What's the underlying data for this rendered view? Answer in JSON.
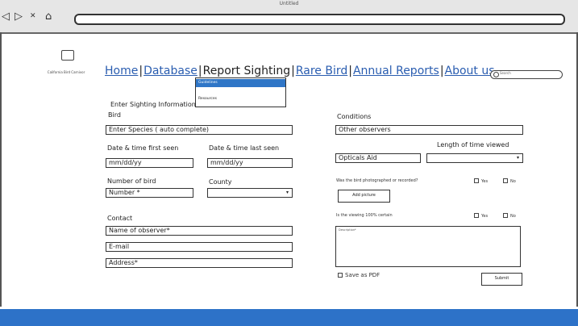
{
  "browser": {
    "title": "Untitled",
    "back_glyph": "◁",
    "forward_glyph": "▷",
    "close_glyph": "✕",
    "home_glyph": "⌂"
  },
  "logo": {
    "text": "California Bird Carnivor"
  },
  "nav": {
    "home": "Home",
    "database": "Database",
    "report": "Report Sighting",
    "rare": "Rare Bird",
    "annual": "Annual Reports",
    "about": "About us",
    "sep": "|"
  },
  "search": {
    "placeholder": "Search"
  },
  "dropdown": {
    "item1": "Guidelines",
    "item2": "Resources"
  },
  "form": {
    "heading": "Enter Sighting Information",
    "bird_label": "Bird",
    "species_value": "Enter Species ( auto complete)",
    "date_first_label": "Date & time first seen",
    "date_last_label": "Date & time last seen",
    "date_first_value": "mm/dd/yy",
    "date_last_value": "mm/dd/yy",
    "number_label": "Number of bird",
    "county_label": "County",
    "number_value": "Number *",
    "county_value": "",
    "contact_label": "Contact",
    "name_value": "Name of observer*",
    "email_value": "E-mail",
    "address_value": "Address*",
    "conditions_label": "Conditions",
    "other_observers_value": "Other observers",
    "length_label": "Length of time viewed",
    "optical_value": "Opticals Aid",
    "length_value": "",
    "photo_question": "Was the bird photographed or recorded?",
    "yes": "Yes",
    "no": "No",
    "add_picture": "Add picture",
    "certain_question": "Is the viewing 100% certain",
    "description_placeholder": "Description*",
    "save_pdf": "Save as PDF",
    "submit": "Submit",
    "caret": "▾"
  }
}
